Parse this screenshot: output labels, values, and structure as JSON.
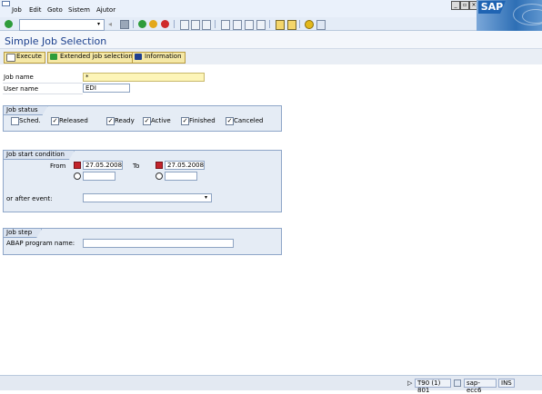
{
  "menu": {
    "items": [
      "Job",
      "Edit",
      "Goto",
      "Sistem",
      "Ajutor"
    ]
  },
  "window_controls": [
    "minimize-icon",
    "restore-icon",
    "close-icon"
  ],
  "logo": {
    "text": "SAP",
    "color": "#1f64b3"
  },
  "toolbar": {
    "command_field_value": "",
    "icons": [
      "enter-icon",
      "save-icon",
      "back-icon",
      "exit-icon",
      "cancel-icon",
      "print-icon",
      "find-icon",
      "find-next-icon",
      "first-page-icon",
      "previous-page-icon",
      "next-page-icon",
      "last-page-icon",
      "new-session-icon",
      "shortcut-icon",
      "help-icon",
      "layout-menu-icon"
    ]
  },
  "page": {
    "title": "Simple Job Selection"
  },
  "app_toolbar": {
    "execute_label": "Execute",
    "extended_label": "Extended job selection",
    "information_label": "Information"
  },
  "form": {
    "job_name_label": "Job name",
    "job_name_value": "*",
    "user_name_label": "User name",
    "user_name_value": "EDI"
  },
  "job_status": {
    "title": "Job status",
    "options": [
      {
        "label": "Sched.",
        "checked": false
      },
      {
        "label": "Released",
        "checked": true
      },
      {
        "label": "Ready",
        "checked": true
      },
      {
        "label": "Active",
        "checked": true
      },
      {
        "label": "Finished",
        "checked": true
      },
      {
        "label": "Canceled",
        "checked": true
      }
    ]
  },
  "start_condition": {
    "title": "Job start condition",
    "from_label": "From",
    "from_date": "27.05.2008",
    "from_time": "",
    "to_label": "To",
    "to_date": "27.05.2008",
    "to_time": "",
    "event_label": "or after event:",
    "event_value": ""
  },
  "job_step": {
    "title": "Job step",
    "abap_label": "ABAP program name:",
    "abap_value": ""
  },
  "status_bar": {
    "system": "T90 (1) 801",
    "server": "sap-ecc6",
    "mode": "INS"
  },
  "colors": {
    "required_field": "#fdf5b8",
    "title_text": "#1b3f8c",
    "group_background": "#e5ecf5",
    "button_background": "#f5e8a6"
  }
}
